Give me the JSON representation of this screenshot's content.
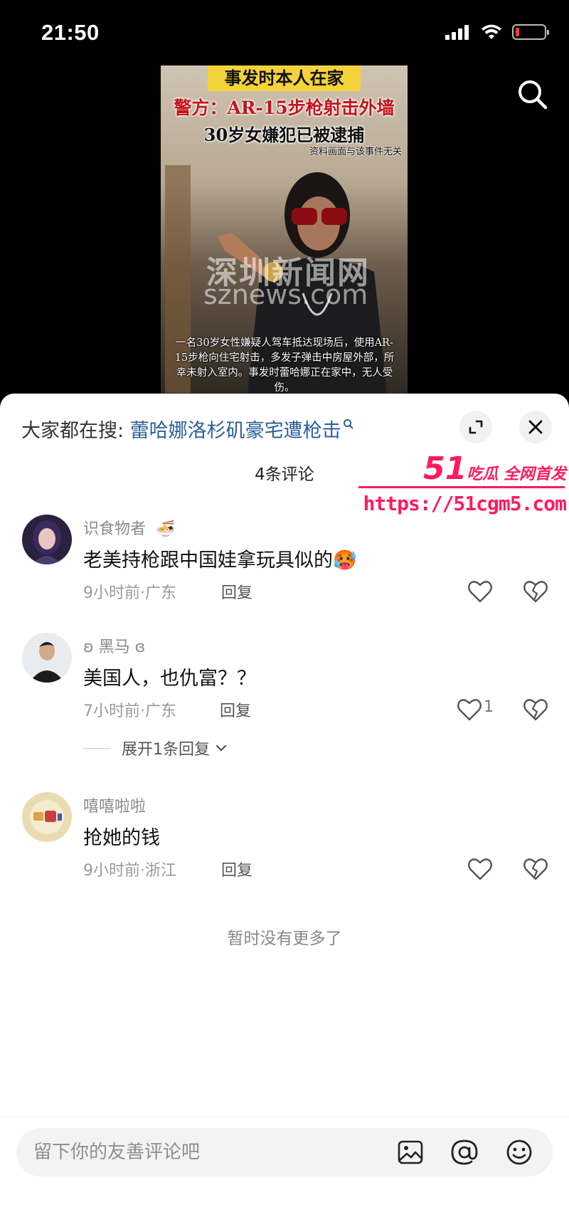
{
  "status_bar": {
    "time": "21:50",
    "battery_color": "#ff3b30",
    "battery_level": 0.12
  },
  "video": {
    "banner": "事发时本人在家",
    "title_line1": "警方：AR-15步枪射击外墙",
    "title_line2": "30岁女嫌犯已被逮捕",
    "note": "资料画面与该事件无关",
    "watermark_cn": "深圳新闻网",
    "watermark_en": "sznews.com",
    "subtitle": "一名30岁女性嫌疑人驾车抵达现场后，使用AR-15步枪向住宅射击，多发子弹击中房屋外部，所幸未射入室内。事发时蕾哈娜正在家中，无人受伤。"
  },
  "icons": {
    "search": "search-icon",
    "expand": "expand-icon",
    "close": "close-icon",
    "like": "heart-icon",
    "dislike": "broken-heart-icon",
    "image": "image-icon",
    "mention": "at-icon",
    "emoji": "emoji-icon"
  },
  "sheet": {
    "hot_search_label": "大家都在搜: ",
    "hot_search_term": "蕾哈娜洛杉矶豪宅遭枪击",
    "comment_count": "4条评论",
    "accent_color": "#2b5f97"
  },
  "promo": {
    "logo_num": "51",
    "logo_text": "吃瓜 全网首发",
    "url": "https://51cgm5.com",
    "color": "#ff1a5e"
  },
  "comments": [
    {
      "user": "识食物者",
      "user_emoji": "🍜",
      "text": "老美持枪跟中国娃拿玩具似的",
      "text_emoji": "🥵",
      "meta": "9小时前·广东",
      "reply": "回复",
      "likes": ""
    },
    {
      "user": "ʚ 黑马 ɞ",
      "text": "美国人，也仇富？？",
      "meta": "7小时前·广东",
      "reply": "回复",
      "likes": "1",
      "expand": "展开1条回复"
    },
    {
      "user": "嘻嘻啦啦",
      "text": "抢她的钱",
      "meta": "9小时前·浙江",
      "reply": "回复",
      "likes": ""
    }
  ],
  "no_more": "暂时没有更多了",
  "input": {
    "placeholder": "留下你的友善评论吧",
    "value": ""
  }
}
